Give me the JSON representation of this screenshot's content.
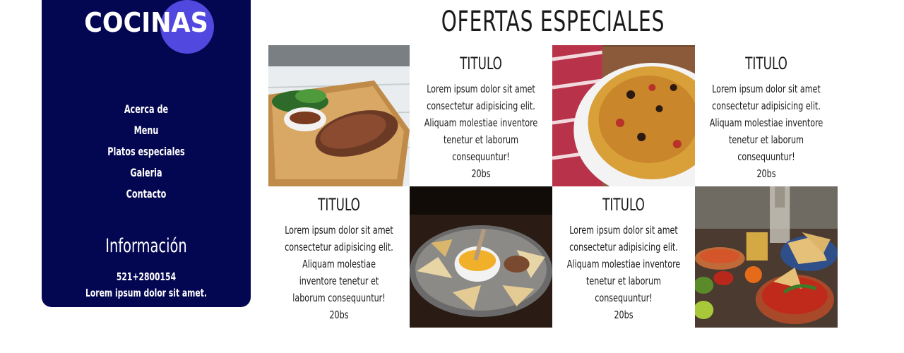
{
  "sidebar": {
    "logo_text": "COCINAS",
    "nav": [
      {
        "label": "Acerca de"
      },
      {
        "label": "Menu"
      },
      {
        "label": "Platos especiales"
      },
      {
        "label": "Galeria"
      },
      {
        "label": "Contacto"
      }
    ],
    "info_title": "Información",
    "phone": "521+2800154",
    "info_text": "Lorem ipsum dolor sit amet."
  },
  "main": {
    "title": "OFERTAS ESPECIALES",
    "cards": [
      {
        "title": "TITULO",
        "description": "Lorem ipsum dolor sit amet consectetur adipisicing elit. Aliquam molestiae inventore tenetur et laborum consequuntur!",
        "price": "20bs"
      },
      {
        "title": "TITULO",
        "description": "Lorem ipsum dolor sit amet consectetur adipisicing elit. Aliquam molestiae inventore tenetur et laborum consequuntur!",
        "price": "20bs"
      },
      {
        "title": "TITULO",
        "description": "Lorem ipsum dolor sit amet consectetur adipisicing elit. Aliquam molestiae inventore tenetur et laborum consequuntur!",
        "price": "20bs"
      },
      {
        "title": "TITULO",
        "description": "Lorem ipsum dolor sit amet consectetur adipisicing elit. Aliquam molestiae inventore tenetur et laborum consequuntur!",
        "price": "20bs"
      }
    ]
  },
  "colors": {
    "sidebar_bg": "#030650",
    "logo_circle": "#5148e0",
    "text_dark": "#1a1a1a"
  }
}
